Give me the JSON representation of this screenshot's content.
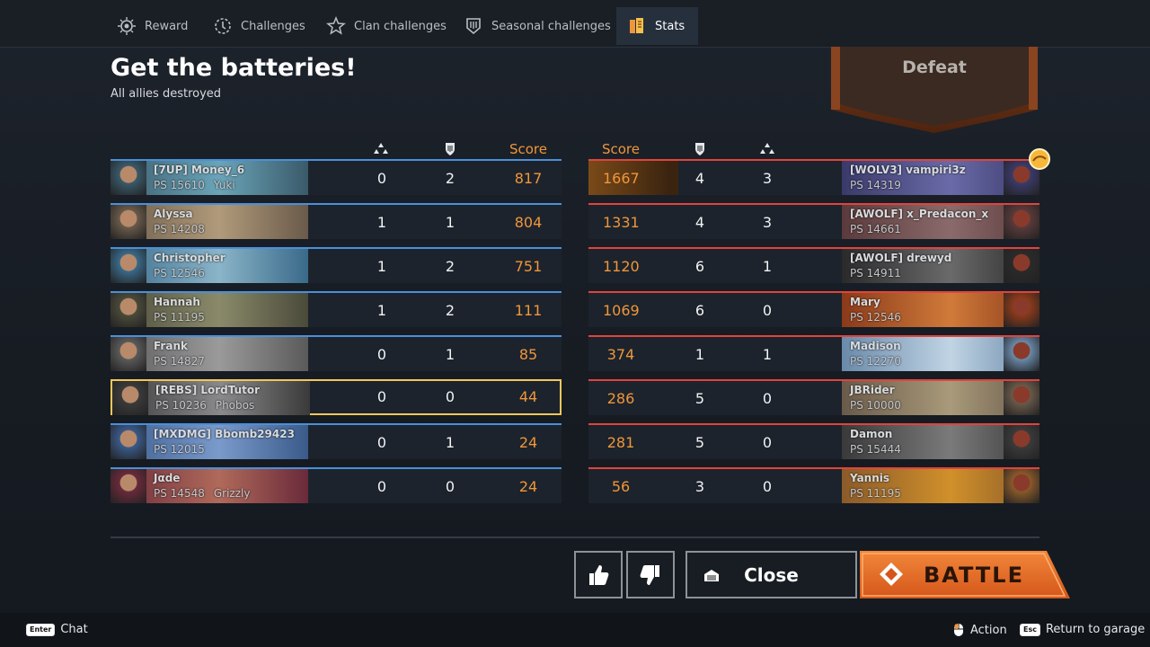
{
  "tabs": [
    {
      "label": "Reward",
      "icon": "reward-icon"
    },
    {
      "label": "Challenges",
      "icon": "challenges-icon"
    },
    {
      "label": "Clan challenges",
      "icon": "clan-challenges-icon"
    },
    {
      "label": "Seasonal challenges",
      "icon": "seasonal-challenges-icon"
    },
    {
      "label": "Stats",
      "icon": "stats-icon",
      "active": true
    }
  ],
  "header": {
    "title": "Get the batteries!",
    "subtitle": "All allies destroyed",
    "result": "Defeat"
  },
  "columns": {
    "score_label": "Score",
    "kills_icon": "kills-icon",
    "assists_icon": "assists-icon"
  },
  "allies": [
    {
      "name": "[7UP] Money_6",
      "ps": "PS 15610",
      "clan": "Yuki",
      "col1": "0",
      "col2": "2",
      "score": "817"
    },
    {
      "name": "Alyssa",
      "ps": "PS 14208",
      "clan": "",
      "col1": "1",
      "col2": "1",
      "score": "804"
    },
    {
      "name": "Christopher",
      "ps": "PS 12546",
      "clan": "",
      "col1": "1",
      "col2": "2",
      "score": "751"
    },
    {
      "name": "Hannah",
      "ps": "PS 11195",
      "clan": "",
      "col1": "1",
      "col2": "2",
      "score": "111"
    },
    {
      "name": "Frank",
      "ps": "PS 14827",
      "clan": "",
      "col1": "0",
      "col2": "1",
      "score": "85"
    },
    {
      "name": "[REBS] LordTutor",
      "ps": "PS 10236",
      "clan": "Phobos",
      "col1": "0",
      "col2": "0",
      "score": "44"
    },
    {
      "name": "[MXDMG] Bbomb29423",
      "ps": "PS 12015",
      "clan": "",
      "col1": "0",
      "col2": "1",
      "score": "24"
    },
    {
      "name": "Jαde",
      "ps": "PS 14548",
      "clan": "Grizzly",
      "col1": "0",
      "col2": "0",
      "score": "24"
    }
  ],
  "enemies": [
    {
      "name": "[WOLV3] vampiri3z",
      "ps": "PS 14319",
      "score": "1667",
      "col2": "4",
      "col3": "3"
    },
    {
      "name": "[AWOLF] x_Predacon_x",
      "ps": "PS 14661",
      "score": "1331",
      "col2": "4",
      "col3": "3"
    },
    {
      "name": "[AWOLF] drewyd",
      "ps": "PS 14911",
      "score": "1120",
      "col2": "6",
      "col3": "1"
    },
    {
      "name": "Mary",
      "ps": "PS 12546",
      "score": "1069",
      "col2": "6",
      "col3": "0"
    },
    {
      "name": "Madison",
      "ps": "PS 12270",
      "score": "374",
      "col2": "1",
      "col3": "1"
    },
    {
      "name": "JBRider",
      "ps": "PS 10000",
      "score": "286",
      "col2": "5",
      "col3": "0"
    },
    {
      "name": "Damon",
      "ps": "PS 15444",
      "score": "281",
      "col2": "5",
      "col3": "0"
    },
    {
      "name": "Yannis",
      "ps": "PS 11195",
      "score": "56",
      "col2": "3",
      "col3": "0"
    }
  ],
  "buttons": {
    "close": "Close",
    "battle": "BATTLE"
  },
  "footer": {
    "chat_key": "Enter",
    "chat": "Chat",
    "action": "Action",
    "esc_key": "Esc",
    "return": "Return to garage"
  }
}
